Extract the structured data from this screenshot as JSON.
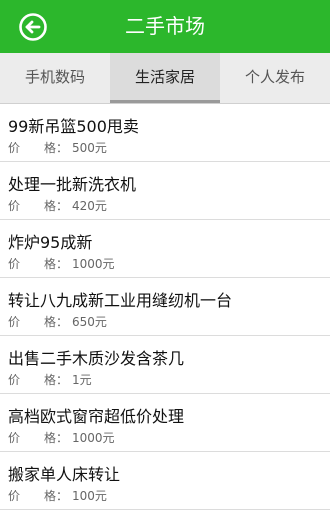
{
  "header": {
    "title": "二手市场"
  },
  "tabs": [
    {
      "label": "手机数码",
      "active": false
    },
    {
      "label": "生活家居",
      "active": true
    },
    {
      "label": "个人发布",
      "active": false
    }
  ],
  "list": {
    "items": [
      {
        "title": "99新吊篮500甩卖",
        "price_label": "价　　格：",
        "price": "500元"
      },
      {
        "title": "处理一批新洗衣机",
        "price_label": "价　　格：",
        "price": "420元"
      },
      {
        "title": "炸炉95成新",
        "price_label": "价　　格：",
        "price": "1000元"
      },
      {
        "title": "转让八九成新工业用缝纫机一台",
        "price_label": "价　　格：",
        "price": "650元"
      },
      {
        "title": "出售二手木质沙发含茶几",
        "price_label": "价　　格：",
        "price": "1元"
      },
      {
        "title": "高档欧式窗帘超低价处理",
        "price_label": "价　　格：",
        "price": "1000元"
      },
      {
        "title": "搬家单人床转让",
        "price_label": "价　　格：",
        "price": "100元"
      }
    ]
  },
  "colors": {
    "header_bg": "#2cb72c",
    "tab_bg": "#ececec",
    "tab_active_bg": "#dcdcdc"
  },
  "icons": {
    "back": "back-arrow-circle-icon"
  }
}
